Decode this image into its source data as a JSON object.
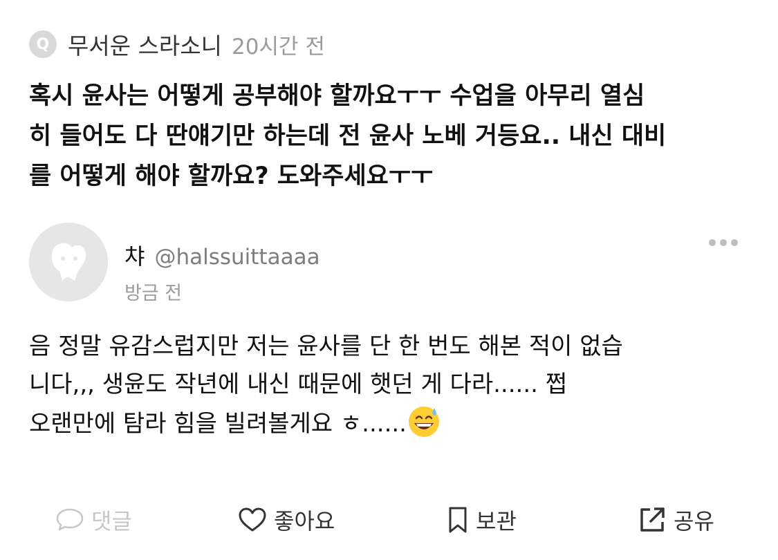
{
  "question": {
    "badge_letter": "Q",
    "asker": "무서운 스라소니",
    "time": "20시간 전",
    "lines": [
      "혹시 윤사는 어떻게 공부해야 할까요ㅜㅜ 수업을 아무리 열심",
      "히 들어도 다 딴얘기만 하는데 전 윤사 노베 거등요.. 내신 대비",
      "를 어떻게 해야 할까요? 도와주세요ㅜㅜ"
    ]
  },
  "answer": {
    "name": "챠",
    "handle": "@halssuittaaaa",
    "time": "방금 전",
    "lines": [
      "음 정말 유감스럽지만 저는 윤사를 단 한 번도 해본 적이 없습",
      "니다,,, 생윤도 작년에 내신 때문에 햇던 게 다라...... 쩝",
      "오랜만에 탐라 힘을 빌려볼게요 ㅎ......"
    ]
  },
  "actions": {
    "comment": "댓글",
    "like": "좋아요",
    "save": "보관",
    "share": "공유"
  },
  "icons": {
    "more": "more-horizontal-icon",
    "comment": "speech-bubble-icon",
    "like": "heart-icon",
    "save": "bookmark-icon",
    "share": "share-external-icon",
    "emoji": "grinning-sweat-emoji"
  }
}
